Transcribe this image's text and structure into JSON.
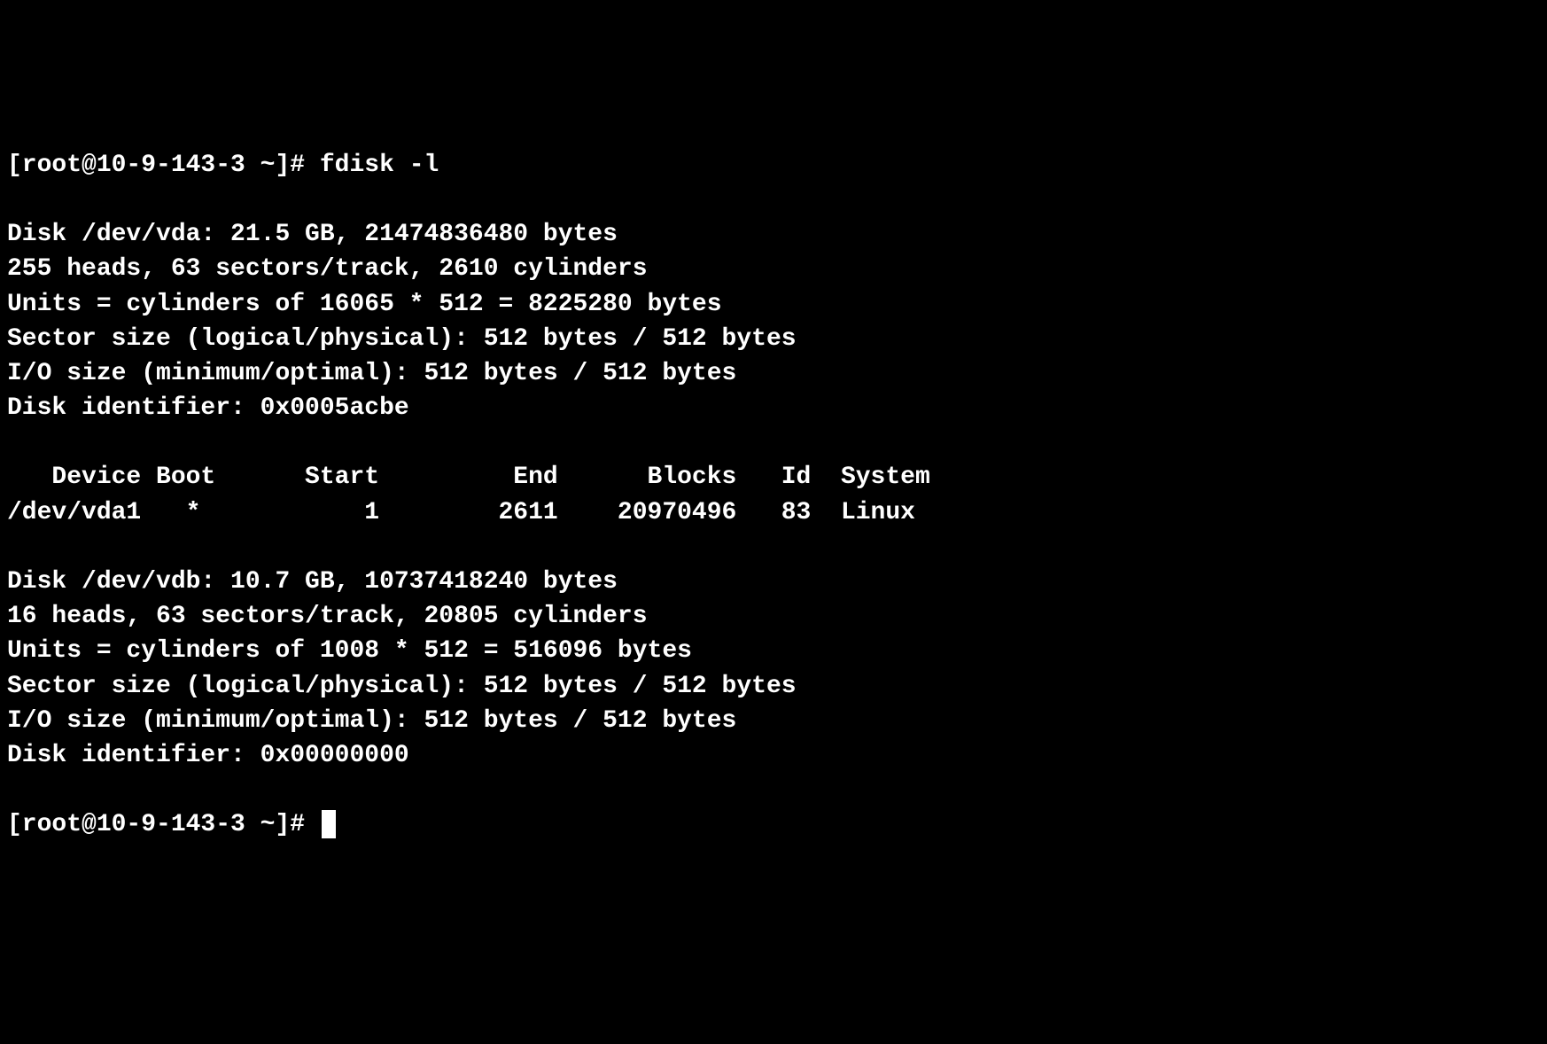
{
  "prompt1": {
    "user_host": "[root@10-9-143-3 ~]#",
    "command": "fdisk -l"
  },
  "disk1": {
    "header": "Disk /dev/vda: 21.5 GB, 21474836480 bytes",
    "geometry": "255 heads, 63 sectors/track, 2610 cylinders",
    "units": "Units = cylinders of 16065 * 512 = 8225280 bytes",
    "sector_size": "Sector size (logical/physical): 512 bytes / 512 bytes",
    "io_size": "I/O size (minimum/optimal): 512 bytes / 512 bytes",
    "identifier": "Disk identifier: 0x0005acbe"
  },
  "partition_table": {
    "header": "   Device Boot      Start         End      Blocks   Id  System",
    "row1": "/dev/vda1   *           1        2611    20970496   83  Linux"
  },
  "disk2": {
    "header": "Disk /dev/vdb: 10.7 GB, 10737418240 bytes",
    "geometry": "16 heads, 63 sectors/track, 20805 cylinders",
    "units": "Units = cylinders of 1008 * 512 = 516096 bytes",
    "sector_size": "Sector size (logical/physical): 512 bytes / 512 bytes",
    "io_size": "I/O size (minimum/optimal): 512 bytes / 512 bytes",
    "identifier": "Disk identifier: 0x00000000"
  },
  "prompt2": {
    "user_host": "[root@10-9-143-3 ~]#"
  }
}
